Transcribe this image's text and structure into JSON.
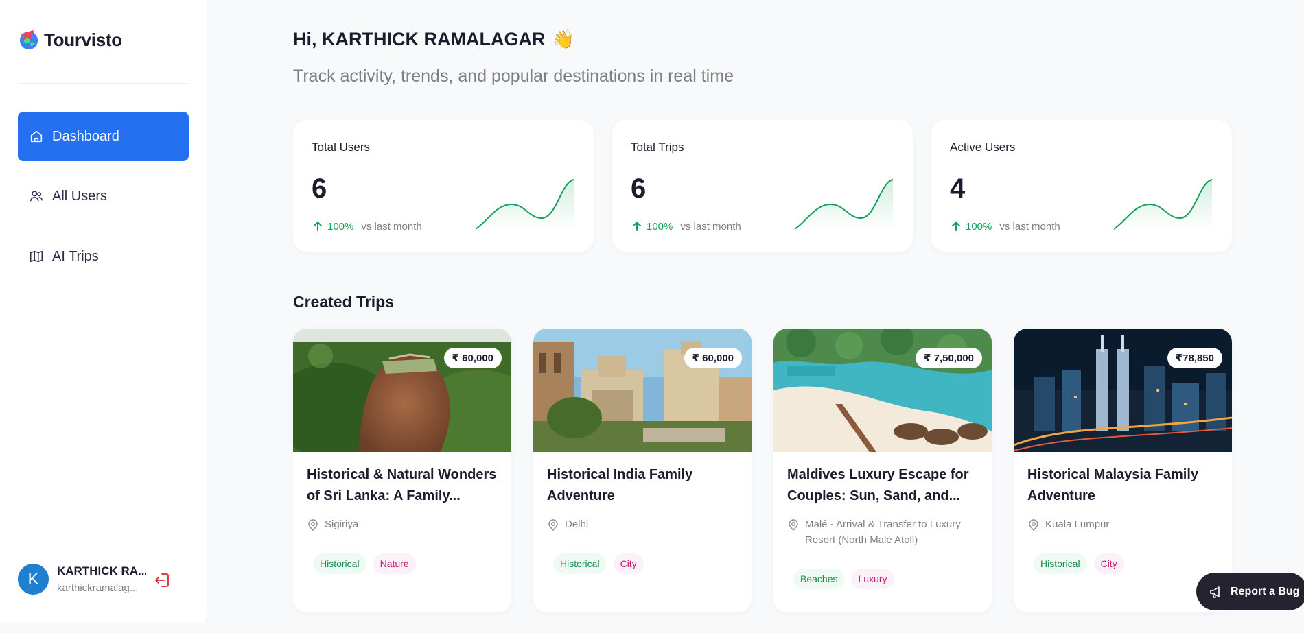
{
  "app": {
    "name": "Tourvisto"
  },
  "sidebar": {
    "items": [
      {
        "label": "Dashboard",
        "icon": "home-icon",
        "active": true
      },
      {
        "label": "All Users",
        "icon": "users-icon",
        "active": false
      },
      {
        "label": "AI Trips",
        "icon": "map-icon",
        "active": false
      }
    ],
    "user": {
      "initial": "K",
      "name": "KARTHICK RA...",
      "email": "karthickramalag..."
    }
  },
  "header": {
    "greeting": "Hi, KARTHICK RAMALAGAR",
    "wave": "👋",
    "subtitle": "Track activity, trends, and popular destinations in real time"
  },
  "stats": [
    {
      "title": "Total Users",
      "value": "6",
      "change": "100%",
      "note": "vs last month",
      "trend": "up"
    },
    {
      "title": "Total Trips",
      "value": "6",
      "change": "100%",
      "note": "vs last month",
      "trend": "up"
    },
    {
      "title": "Active Users",
      "value": "4",
      "change": "100%",
      "note": "vs last month",
      "trend": "up"
    }
  ],
  "created_trips": {
    "title": "Created Trips",
    "trips": [
      {
        "price": "₹ 60,000",
        "name": "Historical & Natural Wonders of Sri Lanka: A Family...",
        "location": "Sigiriya",
        "tags": [
          "Historical",
          "Nature"
        ]
      },
      {
        "price": "₹ 60,000",
        "name": "Historical India Family Adventure",
        "location": "Delhi",
        "tags": [
          "Historical",
          "City"
        ]
      },
      {
        "price": "₹ 7,50,000",
        "name": "Maldives Luxury Escape for Couples: Sun, Sand, and...",
        "location": "Malé - Arrival & Transfer to Luxury Resort (North Malé Atoll)",
        "tags": [
          "Beaches",
          "Luxury"
        ]
      },
      {
        "price": "₹78,850",
        "name": "Historical Malaysia Family Adventure",
        "location": "Kuala Lumpur",
        "tags": [
          "Historical",
          "City"
        ]
      }
    ]
  },
  "report_bug": {
    "label": "Report a Bug"
  },
  "colors": {
    "accent": "#256ff1",
    "positive": "#12a15a",
    "tag_green": "#188b49",
    "tag_pink": "#c1196c"
  }
}
